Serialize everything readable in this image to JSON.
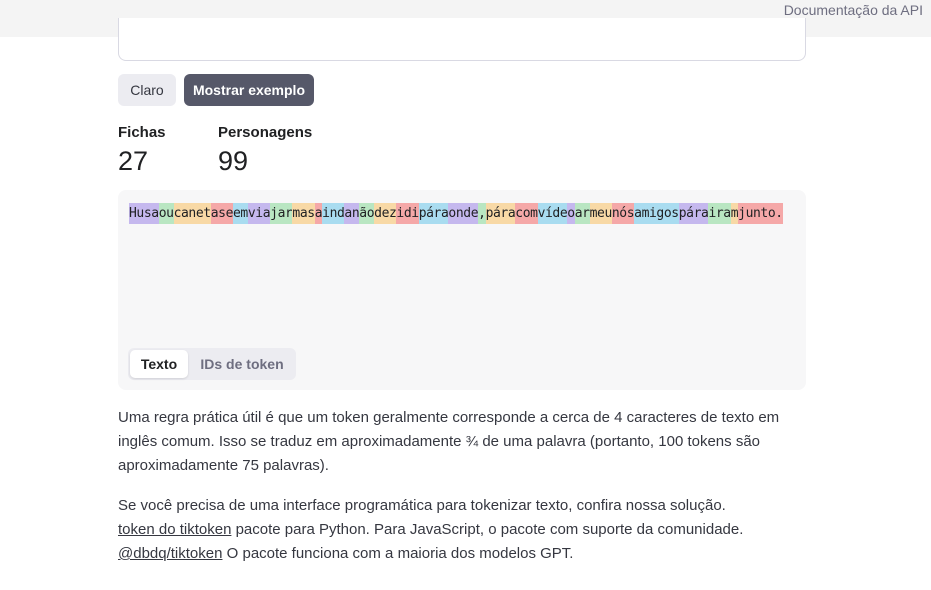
{
  "header": {
    "api_docs_link": "Documentação da API"
  },
  "actions": {
    "clear_label": "Claro",
    "show_example_label": "Mostrar exemplo"
  },
  "stats": {
    "tokens_label": "Fichas",
    "tokens_value": "27",
    "characters_label": "Personagens",
    "characters_value": "99"
  },
  "output": {
    "tokens": [
      "Husa",
      "ou",
      "canet",
      "ase",
      "em",
      "via",
      "jar",
      "mas",
      "a",
      "ind",
      "an",
      "ão",
      "dez",
      "idi",
      "pára",
      "onde",
      ",",
      "pára",
      "com",
      "víde",
      "o",
      "ar",
      "meu",
      "nós",
      "amigos",
      "pára",
      "ira",
      "m",
      "junto."
    ],
    "view_tabs": {
      "text_label": "Texto",
      "ids_label": "IDs de token",
      "selected": "text"
    }
  },
  "explainer": {
    "p1": "Uma regra prática útil é que um token geralmente corresponde a cerca de 4 caracteres de texto em inglês comum. Isso se traduz em aproximadamente ¾ de uma palavra (portanto, 100 tokens são aproximadamente 75 palavras).",
    "p2_a": "Se você precisa de uma interface programática para tokenizar texto, confira nossa solução.",
    "p2_link1": "token do tiktoken",
    "p2_b": " pacote para Python. Para JavaScript, o pacote com suporte da comunidade.",
    "p2_link2": "@dbdq/tiktoken",
    "p2_c": " O pacote funciona com a maioria dos modelos GPT."
  },
  "colors": {
    "token_palette": [
      "#c5b8ee",
      "#b9e6c2",
      "#f8d9a6",
      "#f5a8a8",
      "#a9dcf0"
    ],
    "dark_button": "#565869"
  }
}
